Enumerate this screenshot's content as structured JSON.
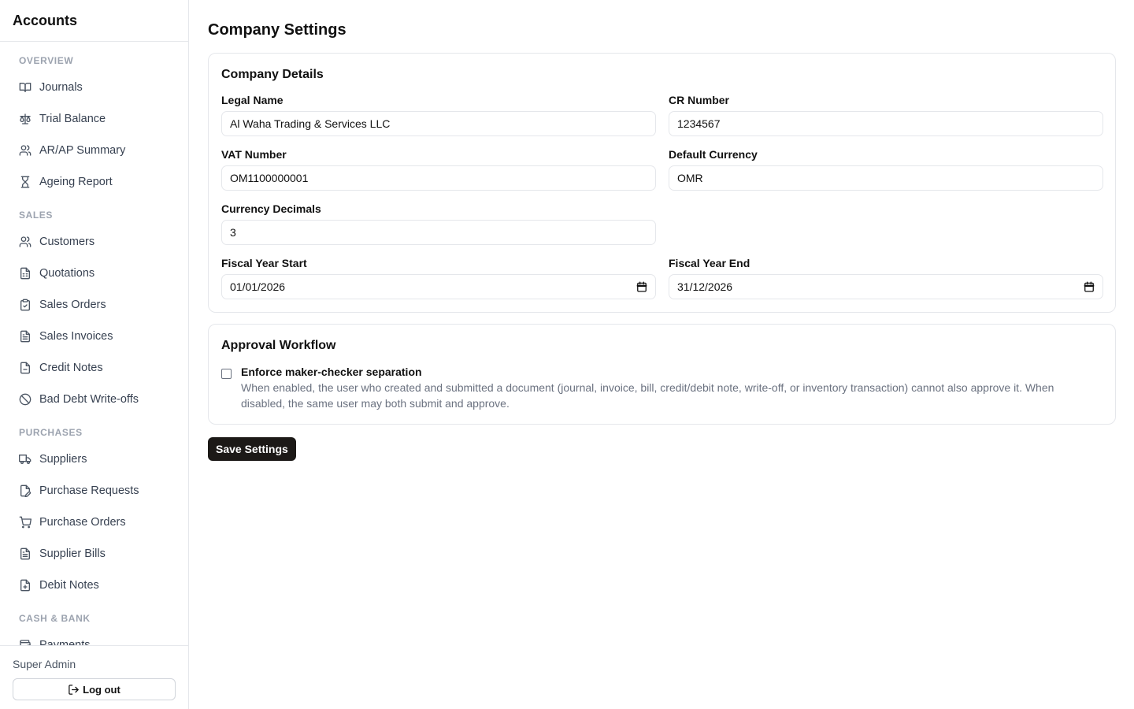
{
  "app": {
    "title": "Accounts"
  },
  "sidebar": {
    "sections": [
      {
        "title": "OVERVIEW",
        "items": [
          {
            "label": "Journals",
            "icon": "book-open-icon"
          },
          {
            "label": "Trial Balance",
            "icon": "scale-icon"
          },
          {
            "label": "AR/AP Summary",
            "icon": "users-icon"
          },
          {
            "label": "Ageing Report",
            "icon": "hourglass-icon"
          }
        ]
      },
      {
        "title": "SALES",
        "items": [
          {
            "label": "Customers",
            "icon": "users-icon"
          },
          {
            "label": "Quotations",
            "icon": "file-spreadsheet-icon"
          },
          {
            "label": "Sales Orders",
            "icon": "clipboard-check-icon"
          },
          {
            "label": "Sales Invoices",
            "icon": "file-text-icon"
          },
          {
            "label": "Credit Notes",
            "icon": "file-icon"
          },
          {
            "label": "Bad Debt Write-offs",
            "icon": "ban-icon"
          }
        ]
      },
      {
        "title": "PURCHASES",
        "items": [
          {
            "label": "Suppliers",
            "icon": "truck-icon"
          },
          {
            "label": "Purchase Requests",
            "icon": "file-pen-icon"
          },
          {
            "label": "Purchase Orders",
            "icon": "shopping-cart-icon"
          },
          {
            "label": "Supplier Bills",
            "icon": "file-text-icon"
          },
          {
            "label": "Debit Notes",
            "icon": "file-plus-icon"
          }
        ]
      },
      {
        "title": "CASH & BANK",
        "items": [
          {
            "label": "Payments",
            "icon": "wallet-icon"
          }
        ]
      }
    ]
  },
  "user": {
    "name": "Super Admin",
    "logout_label": "Log out"
  },
  "page": {
    "title": "Company Settings"
  },
  "company": {
    "title": "Company Details",
    "legal_name": {
      "label": "Legal Name",
      "value": "Al Waha Trading & Services LLC"
    },
    "cr_number": {
      "label": "CR Number",
      "value": "1234567"
    },
    "vat_number": {
      "label": "VAT Number",
      "value": "OM1100000001"
    },
    "default_currency": {
      "label": "Default Currency",
      "value": "OMR"
    },
    "currency_decimals": {
      "label": "Currency Decimals",
      "value": "3"
    },
    "fiscal_year_start": {
      "label": "Fiscal Year Start",
      "value": "01/01/2026"
    },
    "fiscal_year_end": {
      "label": "Fiscal Year End",
      "value": "31/12/2026"
    }
  },
  "approval": {
    "title": "Approval Workflow",
    "checkbox_label": "Enforce maker-checker separation",
    "checked": false,
    "description": "When enabled, the user who created and submitted a document (journal, invoice, bill, credit/debit note, write-off, or inventory transaction) cannot also approve it. When disabled, the same user may both submit and approve."
  },
  "actions": {
    "save_label": "Save Settings"
  }
}
